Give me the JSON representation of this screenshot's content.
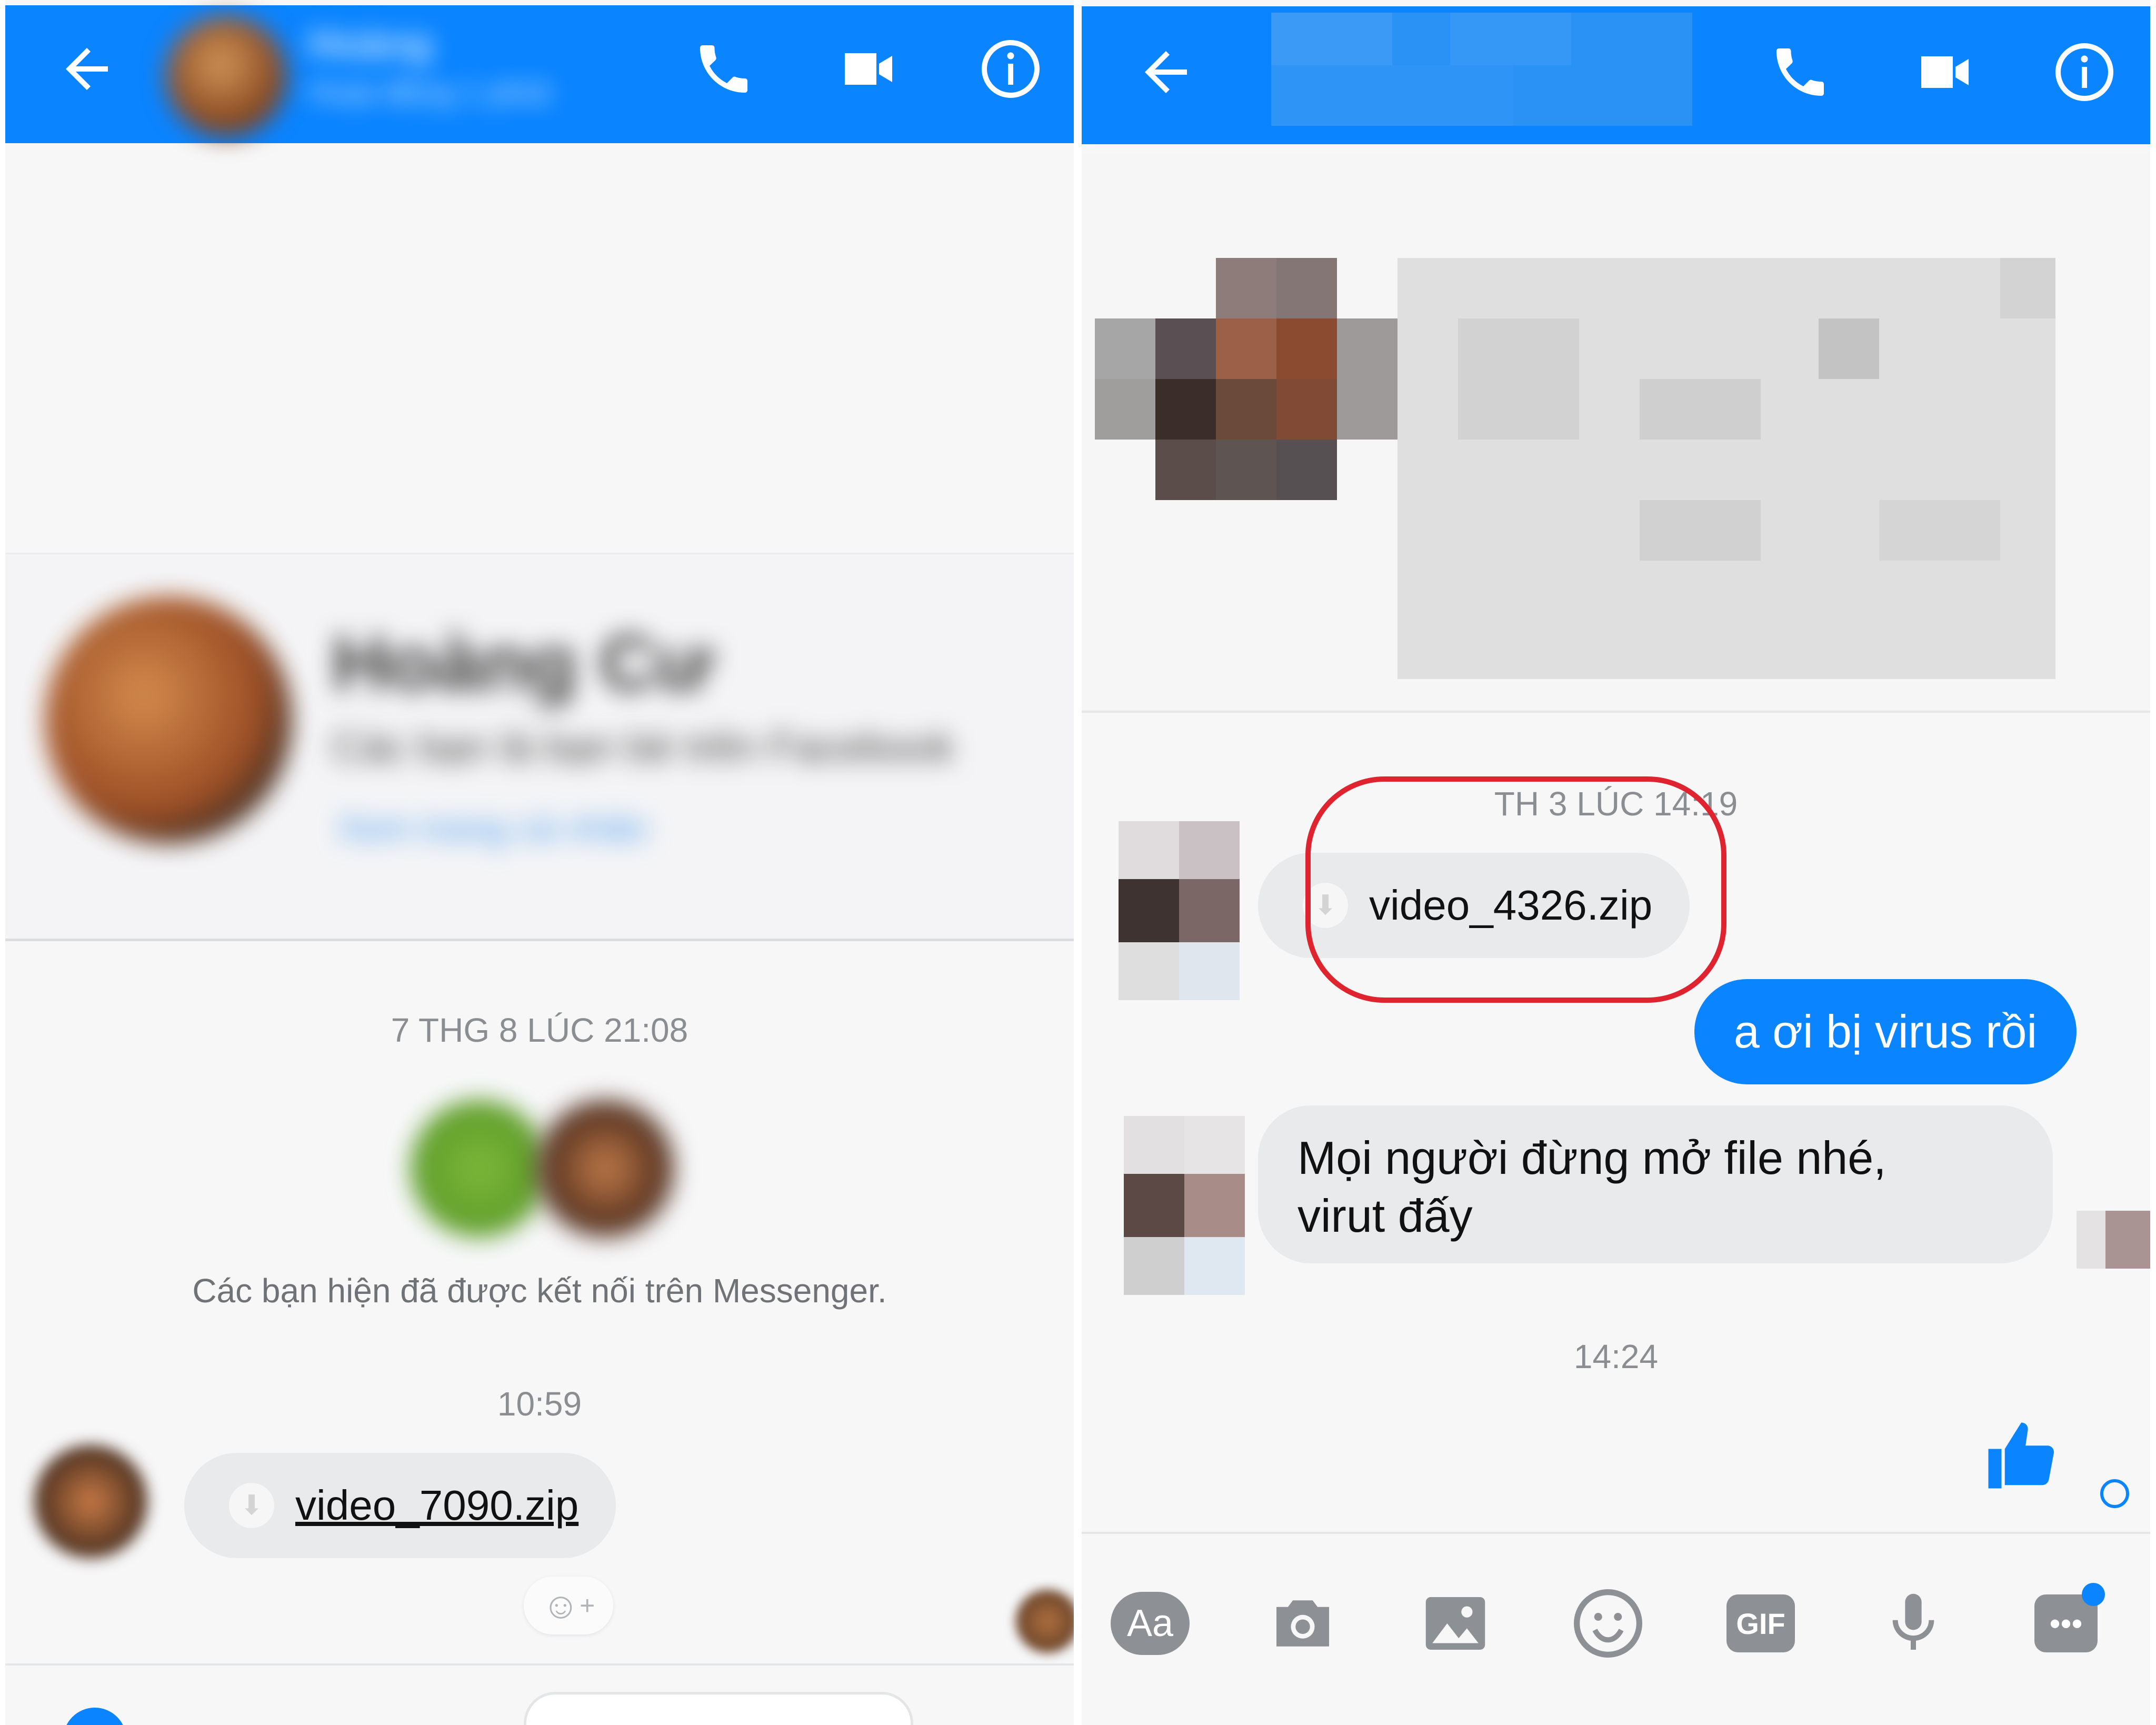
{
  "left": {
    "header": {
      "contact_name": "Hoàng",
      "status": "Hoạt động 1 phút"
    },
    "profile": {
      "name": "Hoàng Cư",
      "subtitle": "Các bạn là bạn bè trên Facebook",
      "link": "Xem trang cá nhân"
    },
    "timestamp_1": "7 THG 8 LÚC 21:08",
    "connected_text": "Các bạn hiện đã được kết nối trên Messenger.",
    "timestamp_2": "10:59",
    "file_name": "video_7090.zip",
    "reaction_icon": "add-reaction-icon"
  },
  "right": {
    "timestamp_1": "TH 3 LÚC 14:19",
    "file_name": "video_4326.zip",
    "outgoing_message": "a ơi bị virus rồi",
    "incoming_message_line1": "Mọi người đừng mở file nhé,",
    "incoming_message_line2": "virut đấy",
    "timestamp_2": "14:24",
    "composer_aa": "Aa",
    "composer_gif": "GIF"
  },
  "colors": {
    "brand_blue": "#0a84ff",
    "highlight_red": "#e0242f",
    "bubble_grey": "#e9eaec"
  }
}
